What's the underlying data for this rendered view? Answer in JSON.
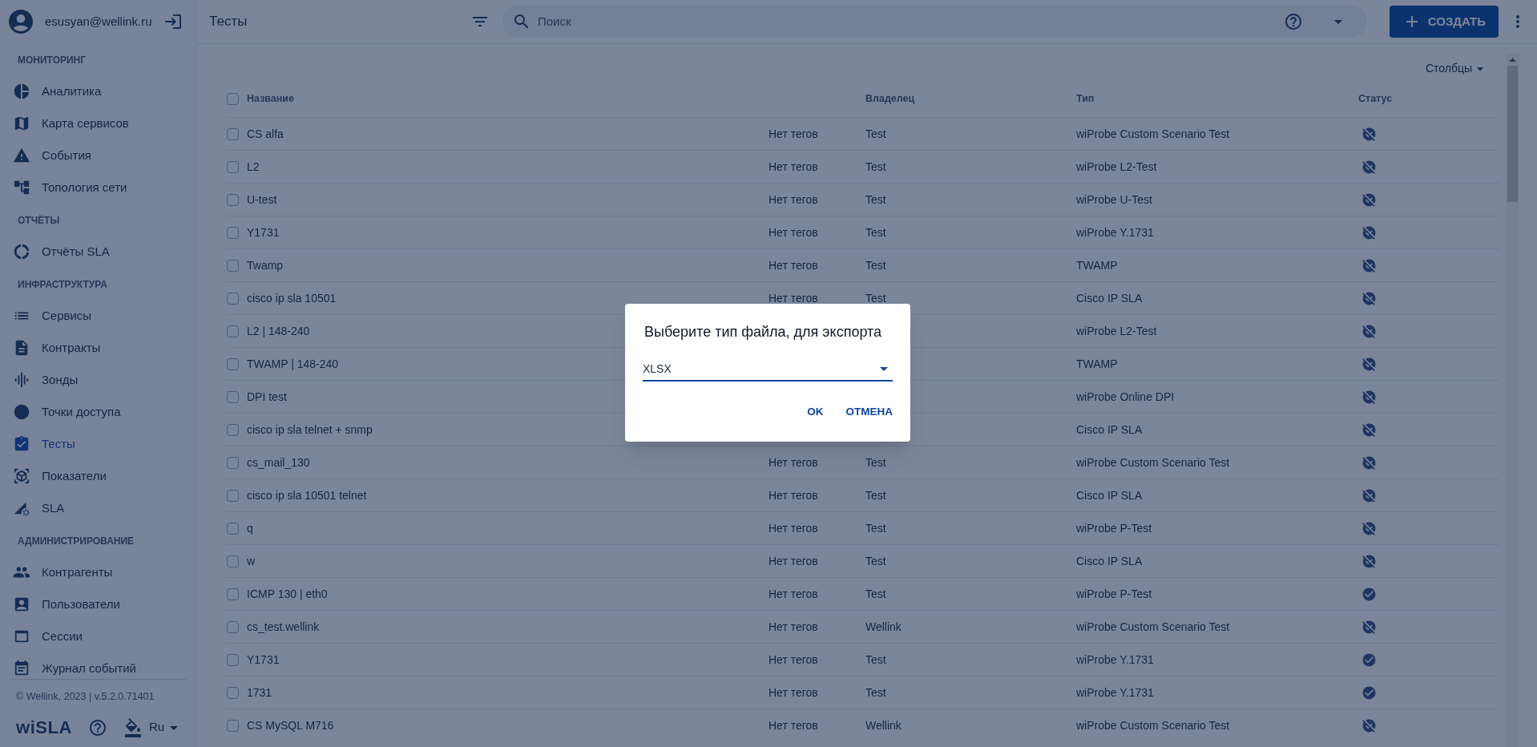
{
  "user": {
    "email": "esusyan@wellink.ru"
  },
  "sidebar": {
    "sections": [
      {
        "title": "МОНИТОРИНГ",
        "items": [
          {
            "label": "Аналитика",
            "selected": false
          },
          {
            "label": "Карта сервисов",
            "selected": false
          },
          {
            "label": "События",
            "selected": false
          },
          {
            "label": "Топология сети",
            "selected": false
          }
        ]
      },
      {
        "title": "ОТЧЁТЫ",
        "items": [
          {
            "label": "Отчёты SLA",
            "selected": false
          }
        ]
      },
      {
        "title": "ИНФРАСТРУКТУРА",
        "items": [
          {
            "label": "Сервисы",
            "selected": false
          },
          {
            "label": "Контракты",
            "selected": false
          },
          {
            "label": "Зонды",
            "selected": false
          },
          {
            "label": "Точки доступа",
            "selected": false
          },
          {
            "label": "Тесты",
            "selected": true
          },
          {
            "label": "Показатели",
            "selected": false
          },
          {
            "label": "SLA",
            "selected": false
          }
        ]
      },
      {
        "title": "АДМИНИСТРИРОВАНИЕ",
        "items": [
          {
            "label": "Контрагенты",
            "selected": false
          },
          {
            "label": "Пользователи",
            "selected": false
          },
          {
            "label": "Сессии",
            "selected": false
          },
          {
            "label": "Журнал событий",
            "selected": false
          }
        ]
      }
    ],
    "footer": "© Wellink, 2023 | v.5.2.0.71401",
    "logo": "wiSLA",
    "language": "Ru"
  },
  "header": {
    "title": "Тесты",
    "search": {
      "placeholder": "Поиск"
    },
    "create_button": "СОЗДАТЬ"
  },
  "columns_button": "Столбцы",
  "table": {
    "all_checked": false,
    "columns": [
      "Название",
      "Владелец",
      "Тип",
      "Статус"
    ],
    "rows": [
      {
        "name": "CS alfa",
        "tags": "Нет тегов",
        "owner": "Test",
        "type": "wiProbe Custom Scenario Test",
        "active": false,
        "checked": false
      },
      {
        "name": "L2",
        "tags": "Нет тегов",
        "owner": "Test",
        "type": "wiProbe L2-Test",
        "active": false,
        "checked": false
      },
      {
        "name": "U-test",
        "tags": "Нет тегов",
        "owner": "Test",
        "type": "wiProbe U-Test",
        "active": false,
        "checked": false
      },
      {
        "name": "Y1731",
        "tags": "Нет тегов",
        "owner": "Test",
        "type": "wiProbe Y.1731",
        "active": false,
        "checked": false
      },
      {
        "name": "Twamp",
        "tags": "Нет тегов",
        "owner": "Test",
        "type": "TWAMP",
        "active": false,
        "checked": false
      },
      {
        "name": "cisco ip sla 10501",
        "tags": "Нет тегов",
        "owner": "Test",
        "type": "Cisco IP SLA",
        "active": false,
        "checked": false
      },
      {
        "name": "L2 | 148-240",
        "type": "wiProbe L2-Test",
        "active": false,
        "checked": false
      },
      {
        "name": "TWAMP | 148-240",
        "type": "TWAMP",
        "active": false,
        "checked": false
      },
      {
        "name": "DPI test",
        "type": "wiProbe Online DPI",
        "active": false,
        "checked": false
      },
      {
        "name": "cisco ip sla telnet + snmp",
        "type": "Cisco IP SLA",
        "active": false,
        "checked": false
      },
      {
        "name": "cs_mail_130",
        "tags": "Нет тегов",
        "owner": "Test",
        "type": "wiProbe Custom Scenario Test",
        "active": false,
        "checked": false
      },
      {
        "name": "cisco ip sla 10501 telnet",
        "tags": "Нет тегов",
        "owner": "Test",
        "type": "Cisco IP SLA",
        "active": false,
        "checked": false
      },
      {
        "name": "q",
        "tags": "Нет тегов",
        "owner": "Test",
        "type": "wiProbe P-Test",
        "active": false,
        "checked": false
      },
      {
        "name": "w",
        "tags": "Нет тегов",
        "owner": "Test",
        "type": "Cisco IP SLA",
        "active": false,
        "checked": false
      },
      {
        "name": "ICMP 130 | eth0",
        "tags": "Нет тегов",
        "owner": "Test",
        "type": "wiProbe P-Test",
        "active": true,
        "checked": false
      },
      {
        "name": "cs_test.wellink",
        "tags": "Нет тегов",
        "owner": "Wellink",
        "type": "wiProbe Custom Scenario Test",
        "active": false,
        "checked": false
      },
      {
        "name": "Y1731",
        "tags": "Нет тегов",
        "owner": "Test",
        "type": "wiProbe Y.1731",
        "active": true,
        "checked": false
      },
      {
        "name": "1731",
        "tags": "Нет тегов",
        "owner": "Test",
        "type": "wiProbe Y.1731",
        "active": true,
        "checked": false
      },
      {
        "name": "CS MySQL M716",
        "tags": "Нет тегов",
        "owner": "Wellink",
        "type": "wiProbe Custom Scenario Test",
        "active": false,
        "checked": false
      }
    ]
  },
  "dialog": {
    "title": "Выберите тип файла, для экспорта",
    "select_value": "XLSX",
    "buttons": [
      "OK",
      "ОТМЕНА"
    ]
  }
}
